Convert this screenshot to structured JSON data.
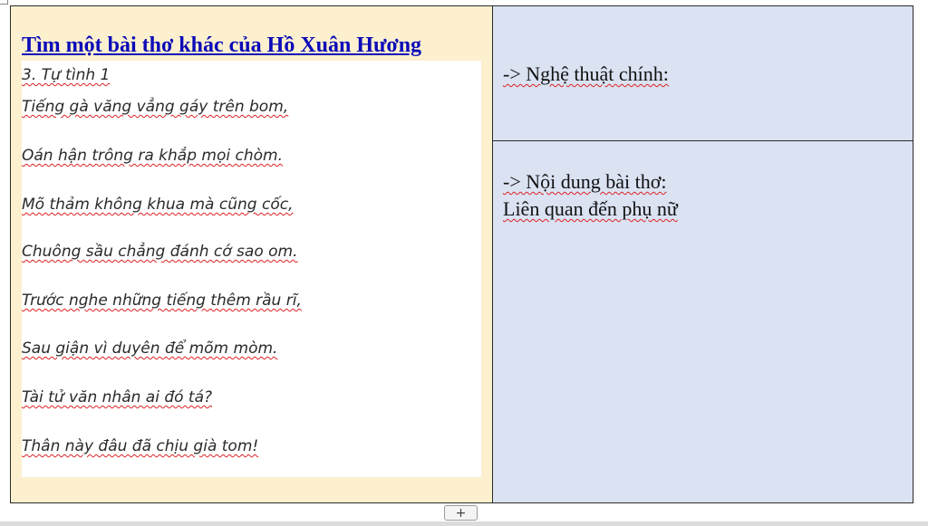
{
  "left_cell": {
    "heading": "Tìm một bài thơ khác của Hồ Xuân Hương",
    "poem": {
      "title": "3. Tự tình 1",
      "lines": [
        "Tiếng gà văng vẳng gáy trên bom,",
        "Oán hận trông ra khắp mọi chòm.",
        "Mõ thảm không khua mà cũng cốc,",
        "Chuông sầu chẳng đánh cớ sao om.",
        "Trước nghe những tiếng thêm rầu rĩ,",
        "Sau giận vì duyên để mõm mòm.",
        "Tài tử văn nhân ai đó tá?",
        "Thân này đâu đã chịu già tom!"
      ]
    }
  },
  "right_top": {
    "text": "-> Nghệ thuật chính:"
  },
  "right_bottom": {
    "line1": "-> Nội dung bài thơ:",
    "line2": "Liên quan đến phụ nữ"
  },
  "controls": {
    "add_label": "+"
  },
  "colors": {
    "left_bg": "#fdf0cf",
    "right_bg": "#dbe2f2",
    "heading": "#0b0bb8",
    "spellcheck": "#dd2222"
  }
}
